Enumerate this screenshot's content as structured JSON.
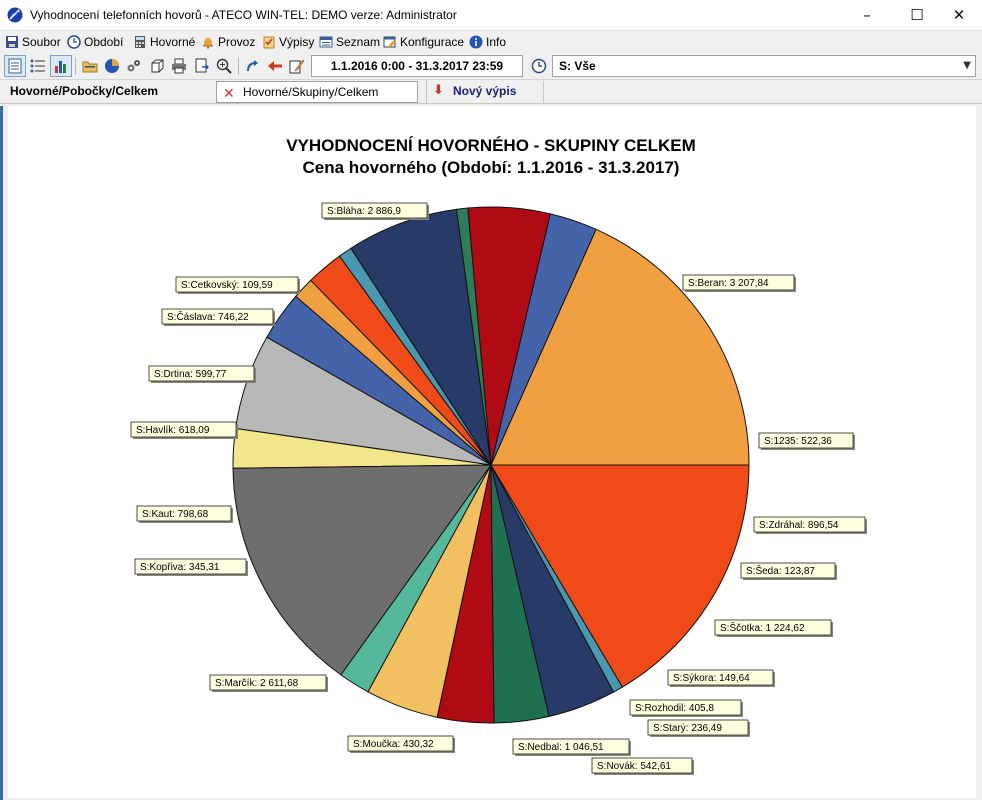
{
  "window": {
    "title": "Vyhodnocení telefonních hovorů - ATECO WIN-TEL: DEMO verze: Administrator",
    "minimize": "–",
    "maximize": "☐",
    "close": "✕"
  },
  "menu": [
    {
      "label": "Soubor",
      "icon": "floppy-icon"
    },
    {
      "label": "Období",
      "icon": "clock-icon"
    },
    {
      "label": "Hovorné",
      "icon": "calculator-icon"
    },
    {
      "label": "Provoz",
      "icon": "bell-icon"
    },
    {
      "label": "Výpisy",
      "icon": "clipboard-icon"
    },
    {
      "label": "Seznam",
      "icon": "list-icon"
    },
    {
      "label": "Konfigurace",
      "icon": "config-icon"
    },
    {
      "label": "Info",
      "icon": "info-icon"
    }
  ],
  "toolbar": {
    "date_range": "1.1.2016 0:00 - 31.3.2017 23:59",
    "filter_value": "S: Vše"
  },
  "tabs": [
    {
      "label": "Hovorné/Pobočky/Celkem"
    },
    {
      "label": "Hovorné/Skupiny/Celkem"
    },
    {
      "label": "Nový výpis"
    }
  ],
  "chart_data": {
    "type": "pie",
    "title": "VYHODNOCENÍ HOVORNÉHO -  SKUPINY CELKEM",
    "subtitle": "Cena hovorného (Období:   1.1.2016 - 31.3.2017)",
    "slices": [
      {
        "label": "S:Beran",
        "value_text": "3 207,84",
        "value": 3207.84,
        "color": "#F0A040"
      },
      {
        "label": "S:1235",
        "value_text": "522,36",
        "value": 522.36,
        "color": "#4463A8"
      },
      {
        "label": "S:Zdráhal",
        "value_text": "896,54",
        "value": 896.54,
        "color": "#B00A14"
      },
      {
        "label": "S:Šeda",
        "value_text": "123,87",
        "value": 123.87,
        "color": "#2E7D5A"
      },
      {
        "label": "S:Ščotka",
        "value_text": "1 224,62",
        "value": 1224.62,
        "color": "#273A68"
      },
      {
        "label": "S:Sýkora",
        "value_text": "149,64",
        "value": 149.64,
        "color": "#4A98B0"
      },
      {
        "label": "S:Rozhodil",
        "value_text": "405,8",
        "value": 405.8,
        "color": "#F04A18"
      },
      {
        "label": "S:Starý",
        "value_text": "236,49",
        "value": 236.49,
        "color": "#F0A040"
      },
      {
        "label": "S:Novák",
        "value_text": "542,61",
        "value": 542.61,
        "color": "#4463A8"
      },
      {
        "label": "S:Nedbal",
        "value_text": "1 046,51",
        "value": 1046.51,
        "color": "#B8B8B8"
      },
      {
        "label": "S:Moučka",
        "value_text": "430,32",
        "value": 430.32,
        "color": "#F2E58A"
      },
      {
        "label": "S:Marčík",
        "value_text": "2 611,68",
        "value": 2611.68,
        "color": "#6E6E6E"
      },
      {
        "label": "S:Kopřiva",
        "value_text": "345,31",
        "value": 345.31,
        "color": "#55B89A"
      },
      {
        "label": "S:Kaut",
        "value_text": "798,68",
        "value": 798.68,
        "color": "#F2C060"
      },
      {
        "label": "S:Havlík",
        "value_text": "618,09",
        "value": 618.09,
        "color": "#B00A14"
      },
      {
        "label": "S:Drtina",
        "value_text": "599,77",
        "value": 599.77,
        "color": "#1E7050"
      },
      {
        "label": "S:Čáslava",
        "value_text": "746,22",
        "value": 746.22,
        "color": "#273A68"
      },
      {
        "label": "S:Cetkovský",
        "value_text": "109,59",
        "value": 109.59,
        "color": "#4A98B0"
      },
      {
        "label": "S:Bláha",
        "value_text": "2 886,9",
        "value": 2886.9,
        "color": "#F04A18"
      }
    ]
  }
}
